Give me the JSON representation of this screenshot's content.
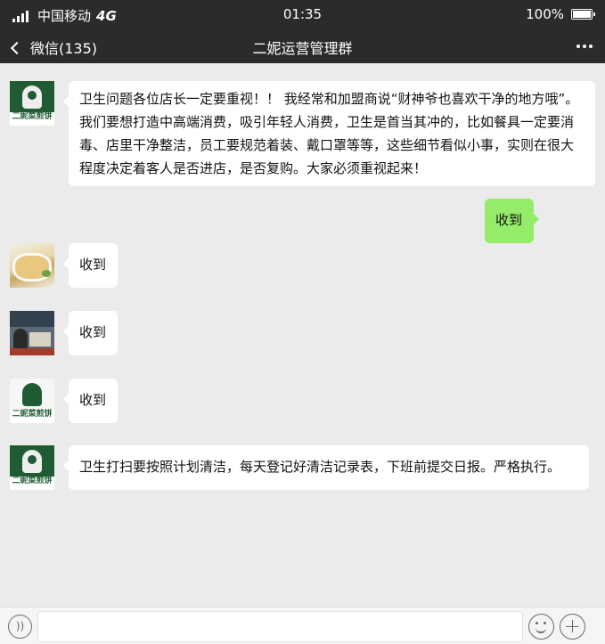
{
  "status_bar": {
    "carrier": "中国移动",
    "network": "4G",
    "time": "01:35",
    "battery_percent": "100%"
  },
  "nav": {
    "back_label": "微信(135)",
    "title": "二妮运营管理群",
    "more_icon": "more-dots-icon"
  },
  "avatar_logo_text": "二妮菜煎饼",
  "messages": [
    {
      "direction": "in",
      "avatar": "brand-logo",
      "text": "卫生问题各位店长一定要重视！！ 我经常和加盟商说“财神爷也喜欢干净的地方哦”。我们要想打造中高端消费，吸引年轻人消费，卫生是首当其冲的，比如餐具一定要消毒、店里干净整洁，员工要规范着装、戴口罩等等，这些细节看似小事，实则在很大程度决定着客人是否进店，是否复购。大家必须重视起来！"
    },
    {
      "direction": "out",
      "text": "收到"
    },
    {
      "direction": "in",
      "avatar": "food-photo",
      "text": "收到"
    },
    {
      "direction": "in",
      "avatar": "group-photo",
      "text": "收到"
    },
    {
      "direction": "in",
      "avatar": "brand-logo",
      "text": "收到"
    },
    {
      "direction": "in",
      "avatar": "brand-logo",
      "text": "卫生打扫要按照计划清洁，每天登记好清洁记录表，下班前提交日报。严格执行。"
    }
  ],
  "input_bar": {
    "voice_icon": "voice-icon",
    "emoji_icon": "emoji-icon",
    "plus_icon": "plus-icon",
    "text_value": ""
  },
  "colors": {
    "bar_background": "#2b2b2c",
    "chat_background": "#ebebeb",
    "outgoing_bubble": "#95ec69",
    "incoming_bubble": "#ffffff",
    "logo_green": "#1f5b33"
  }
}
